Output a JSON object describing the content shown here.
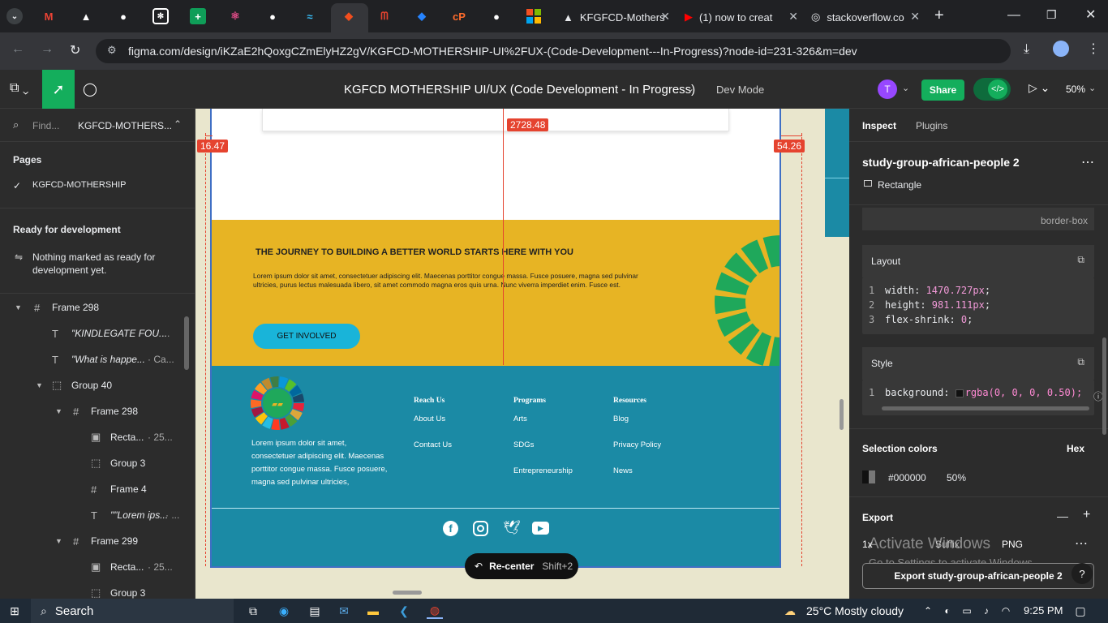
{
  "browser": {
    "tabs_icons": [
      "chevron-down-icon",
      "gmail-icon",
      "vercel-icon",
      "github-icon",
      "chatgpt-icon",
      "sheets-icon",
      "react-icon",
      "github-icon",
      "tailwind-icon",
      "figma-icon",
      "mongodb-icon",
      "jira-icon",
      "cpanel-icon",
      "github-icon",
      "microsoft-icon"
    ],
    "tab_kgfcd": "KFGFCD-Mothers",
    "tab_youtube": "(1) now to creat",
    "tab_stack": "stackoverflow.co",
    "new_tab": "+",
    "url": "figma.com/design/iKZaE2hQoxgCZmElyHZ2gV/KGFCD-MOTHERSHIP-UI%2FUX-(Code-Development---In-Progress)?node-id=231-326&m=dev"
  },
  "figma": {
    "file_title": "KGFCD MOTHERSHIP UI/UX (Code Development - In Progress)",
    "dev_mode": "Dev Mode",
    "avatar": "T",
    "share": "Share",
    "zoom": "50%"
  },
  "left_panel": {
    "search_placeholder": "Find...",
    "file_name": "KGFCD-MOTHERS...",
    "pages_label": "Pages",
    "page_current": "KGFCD-MOTHERSHIP",
    "ready_label": "Ready for development",
    "ready_text": "Nothing marked as ready for development yet.",
    "layers": [
      {
        "name": "Frame 298",
        "sub": ""
      },
      {
        "name": "\"KINDLEGATE FOU...",
        "sub": "· ..."
      },
      {
        "name": "\"What is happe...",
        "sub": "· Ca..."
      },
      {
        "name": "Group 40",
        "sub": ""
      },
      {
        "name": "Frame 298",
        "sub": ""
      },
      {
        "name": "Recta...",
        "sub": "· 25..."
      },
      {
        "name": "Group 3",
        "sub": ""
      },
      {
        "name": "Frame 4",
        "sub": ""
      },
      {
        "name": "\"\"Lorem ips...",
        "sub": "· ..."
      },
      {
        "name": "Frame 299",
        "sub": ""
      },
      {
        "name": "Recta...",
        "sub": "· 25..."
      },
      {
        "name": "Group 3",
        "sub": ""
      }
    ]
  },
  "canvas": {
    "measure_top": "2728.48",
    "measure_left": "16.47",
    "measure_right": "54.26",
    "hero_title": "THE JOURNEY TO BUILDING A BETTER WORLD STARTS HERE WITH YOU",
    "hero_body": "Lorem ipsum dolor sit amet, consectetuer adipiscing elit. Maecenas porttitor congue massa. Fusce posuere, magna sed pulvinar ultricies, purus lectus malesuada libero, sit amet commodo magna eros quis urna. Nunc viverra imperdiet enim. Fusce est.",
    "cta": "GET INVOLVED",
    "footer_text": "Lorem ipsum dolor sit amet, consectetuer adipiscing elit. Maecenas porttitor congue massa. Fusce posuere, magna sed pulvinar ultricies,",
    "col1_head": "Reach Us",
    "col1_a": "About Us",
    "col1_b": "Contact Us",
    "col2_head": "Programs",
    "col2_a": "Arts",
    "col2_b": "SDGs",
    "col2_c": "Entrepreneurship",
    "col3_head": "Resources",
    "col3_a": "Blog",
    "col3_b": "Privacy Policy",
    "col3_c": "News",
    "recenter": "Re-center",
    "recenter_shortcut": "Shift+2"
  },
  "right_panel": {
    "tab_inspect": "Inspect",
    "tab_plugins": "Plugins",
    "layer_name": "study-group-african-people 2",
    "layer_type": "Rectangle",
    "box_sizing": "border-box",
    "layout_label": "Layout",
    "layout_lines": [
      {
        "n": "1",
        "k": "width: ",
        "v": "1470.727px",
        "e": ";"
      },
      {
        "n": "2",
        "k": "height: ",
        "v": "981.111px",
        "e": ";"
      },
      {
        "n": "3",
        "k": "flex-shrink: ",
        "v": "0",
        "e": ";"
      }
    ],
    "style_label": "Style",
    "style_line_n": "1",
    "style_key": "background: ",
    "style_value": "rgba(0, 0, 0, 0.50);",
    "selection_colors": "Selection colors",
    "hex": "Hex",
    "color_hex": "#000000",
    "color_opacity": "50%",
    "export_label": "Export",
    "export_scale": "1x",
    "export_suffix": "Suffix",
    "export_format": "PNG",
    "export_button": "Export study-group-african-people 2",
    "watermark_1": "Activate Windows",
    "watermark_2": "Go to Settings to activate Windows.",
    "help": "?"
  },
  "taskbar": {
    "search": "Search",
    "weather": "25°C  Mostly cloudy",
    "time": "9:25 PM"
  },
  "colors": {
    "accent_blue": "#1b8aa5",
    "yellow": "#e7b424",
    "green": "#1fa85b",
    "figma_green": "#14ae5c",
    "purple": "#9747ff"
  }
}
